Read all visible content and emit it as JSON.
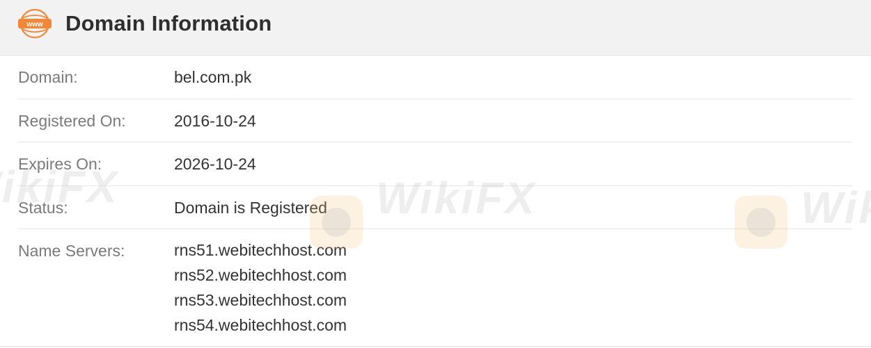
{
  "header": {
    "title": "Domain Information",
    "icon": "www-icon",
    "icon_text": "www",
    "accent_color": "#f0883a"
  },
  "rows": [
    {
      "label": "Domain:",
      "value": "bel.com.pk"
    },
    {
      "label": "Registered On:",
      "value": "2016-10-24"
    },
    {
      "label": "Expires On:",
      "value": "2026-10-24"
    },
    {
      "label": "Status:",
      "value": "Domain is Registered"
    }
  ],
  "name_servers": {
    "label": "Name Servers:",
    "values": [
      "rns51.webitechhost.com",
      "rns52.webitechhost.com",
      "rns53.webitechhost.com",
      "rns54.webitechhost.com"
    ]
  },
  "watermark": {
    "text": "WikiFX"
  }
}
